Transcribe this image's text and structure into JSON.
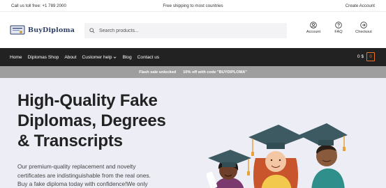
{
  "topbar": {
    "left": "Call us toll free: +1 789 2000",
    "center": "Free shipping to most countries",
    "right": "Create Account"
  },
  "header": {
    "logo_text": "BuyDiploma",
    "search_placeholder": "Search products...",
    "icons": [
      {
        "label": "Account",
        "icon": "account-icon"
      },
      {
        "label": "FAQ",
        "icon": "question-icon"
      },
      {
        "label": "Checkout",
        "icon": "arrow-right-circle-icon"
      }
    ]
  },
  "nav": {
    "items": [
      "Home",
      "Diplomas Shop",
      "About",
      "Customer help",
      "Blog",
      "Contact us"
    ],
    "cart_total": "0 $",
    "cart_count": "0"
  },
  "promo": {
    "left": "Flash sale unlocked",
    "right": "10% off with code \"BUYDIPLOMA\""
  },
  "hero": {
    "title_lines": [
      "High-Quality Fake",
      "Diplomas, Degrees",
      "& Transcripts"
    ],
    "desc_lines": [
      "Our premium-quality replacement and novelty",
      "certificates are indistinguishable from the real ones.",
      "Buy a fake diploma today with confidence!We only"
    ]
  },
  "colors": {
    "nav_bg": "#222222",
    "promo_bg": "#9e9e9e",
    "hero_bg": "#ecedf5",
    "accent": "#e8742a",
    "cap": "#3d5a63"
  }
}
